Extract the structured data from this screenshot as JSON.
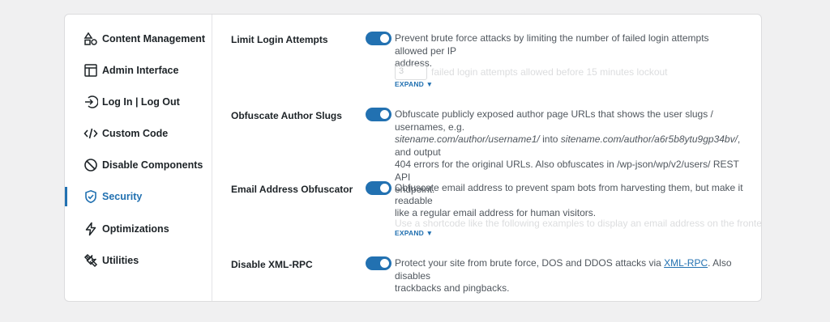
{
  "sidebar": {
    "items": [
      {
        "label": "Content Management",
        "icon": "shapes-icon"
      },
      {
        "label": "Admin Interface",
        "icon": "layout-icon"
      },
      {
        "label": "Log In | Log Out",
        "icon": "login-icon"
      },
      {
        "label": "Custom Code",
        "icon": "code-icon"
      },
      {
        "label": "Disable Components",
        "icon": "prohibited-icon"
      },
      {
        "label": "Security",
        "icon": "shield-icon",
        "active": true
      },
      {
        "label": "Optimizations",
        "icon": "lightning-icon"
      },
      {
        "label": "Utilities",
        "icon": "tools-icon"
      }
    ]
  },
  "settings": {
    "limit_login": {
      "label": "Limit Login Attempts",
      "enabled": true,
      "desc_line1": "Prevent brute force attacks by limiting the number of failed login attempts allowed per IP",
      "desc_line2": "address.",
      "attempts_value": "3",
      "attempts_text": "failed login attempts allowed before 15 minutes lockout",
      "expand": "EXPAND"
    },
    "obfuscate_author": {
      "label": "Obfuscate Author Slugs",
      "enabled": true,
      "desc_a": "Obfuscate publicly exposed author page URLs that shows the user slugs / usernames, e.g.",
      "desc_url1": "sitename.com/author/username1/",
      "desc_into": " into ",
      "desc_url2": "sitename.com/author/a6r5b8ytu9gp34bv/",
      "desc_b": ", and output",
      "desc_c": "404 errors for the original URLs. Also obfuscates in /wp-json/wp/v2/users/ REST API",
      "desc_d": "endpoint."
    },
    "email_obfuscator": {
      "label": "Email Address Obfuscator",
      "enabled": true,
      "desc_line1": "Obfuscate email address to prevent spam bots from harvesting them, but make it readable",
      "desc_line2": "like a regular email address for human visitors.",
      "faded": "Use a shortcode like the following examples to display an email address on the frontend of",
      "expand": "EXPAND"
    },
    "disable_xmlrpc": {
      "label": "Disable XML-RPC",
      "enabled": true,
      "desc_a": "Protect your site from brute force, DOS and DDOS attacks via ",
      "desc_link": "XML-RPC",
      "desc_b": ". Also disables",
      "desc_c": "trackbacks and pingbacks."
    }
  },
  "colors": {
    "accent": "#2271b1",
    "text": "#1d2327",
    "muted": "#50575e",
    "background": "#f0f0f1"
  }
}
